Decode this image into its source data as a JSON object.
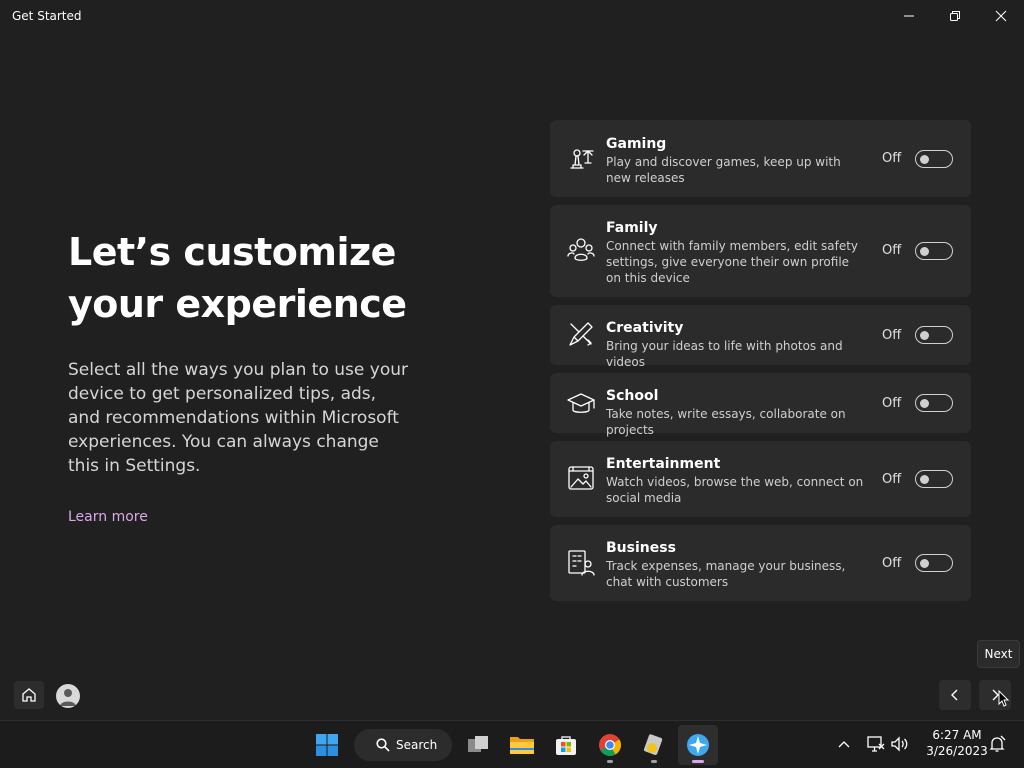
{
  "window": {
    "title": "Get Started"
  },
  "main": {
    "heading": "Let’s customize your experience",
    "description": "Select all the ways you plan to use your device to get personalized tips, ads, and recommendations within Microsoft experiences. You can always change this in Settings.",
    "learn_more": "Learn more"
  },
  "cards": [
    {
      "icon": "gaming-icon",
      "title": "Gaming",
      "description": "Play and discover games, keep up with new releases",
      "state": "Off",
      "on": false
    },
    {
      "icon": "family-icon",
      "title": "Family",
      "description": "Connect with family members, edit safety settings, give everyone their own profile on this device",
      "state": "Off",
      "on": false
    },
    {
      "icon": "creativity-icon",
      "title": "Creativity",
      "description": "Bring your ideas to life with photos and videos",
      "state": "Off",
      "on": false
    },
    {
      "icon": "school-icon",
      "title": "School",
      "description": "Take notes, write essays, collaborate on projects",
      "state": "Off",
      "on": false
    },
    {
      "icon": "entertainment-icon",
      "title": "Entertainment",
      "description": "Watch videos, browse the web, connect on social media",
      "state": "Off",
      "on": false
    },
    {
      "icon": "business-icon",
      "title": "Business",
      "description": "Track expenses, manage your business, chat with customers",
      "state": "Off",
      "on": false
    }
  ],
  "nav": {
    "tooltip": "Next"
  },
  "taskbar": {
    "search_label": "Search",
    "time": "6:27 AM",
    "date": "3/26/2023"
  },
  "colors": {
    "accent": "#d9a8e8",
    "background": "#202020",
    "card": "#2b2b2b"
  }
}
